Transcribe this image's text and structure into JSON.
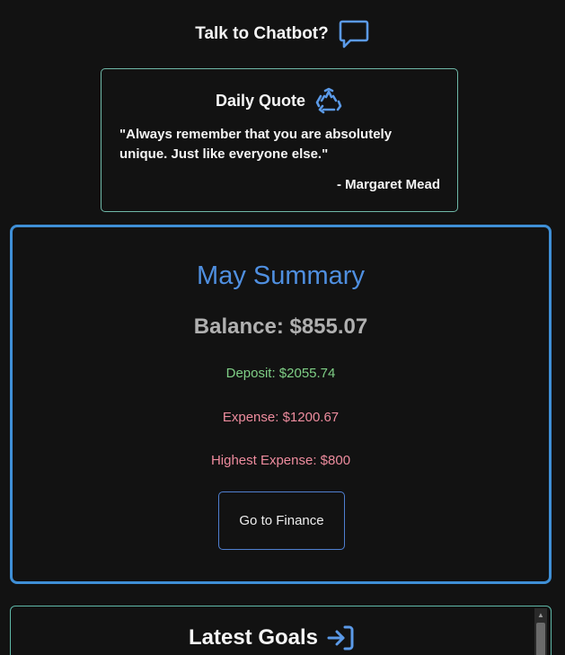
{
  "chatbot": {
    "label": "Talk to Chatbot?",
    "icon": "chat-bubble-icon"
  },
  "quote": {
    "title": "Daily Quote",
    "icon": "recycle-icon",
    "text": "\"Always remember that you are absolutely unique. Just like everyone else.\"",
    "author": "- Margaret Mead"
  },
  "summary": {
    "title": "May Summary",
    "balance": "Balance: $855.07",
    "deposit": "Deposit: $2055.74",
    "expense": "Expense: $1200.67",
    "highest_expense": "Highest Expense: $800",
    "button_label": "Go to Finance"
  },
  "goals": {
    "title": "Latest Goals",
    "icon": "arrow-right-to-bracket-icon"
  },
  "colors": {
    "background": "#121212",
    "summary_border": "#3f8fd6",
    "quote_border": "#6fb8a8",
    "title_blue": "#4f8fe0",
    "deposit_green": "#7fcf86",
    "expense_pink": "#ee8c9e",
    "icon_blue": "#5b9ae8"
  }
}
